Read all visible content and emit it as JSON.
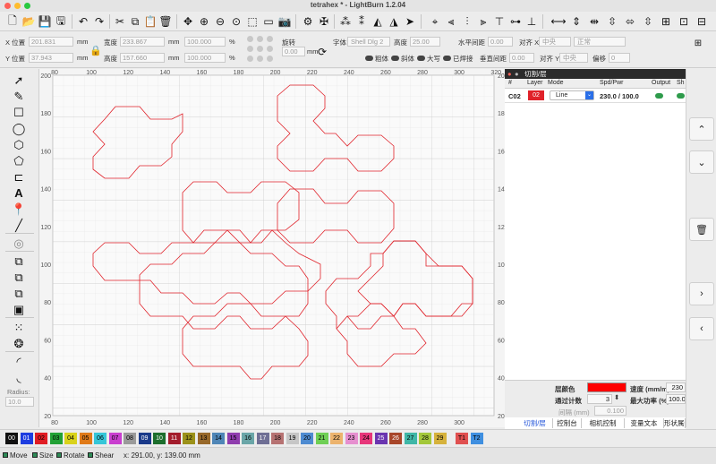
{
  "window": {
    "title": "tetrahex * - LightBurn 1.2.04"
  },
  "toolbar": {
    "icons": [
      "new-file-icon",
      "open-file-icon",
      "save-icon",
      "save-as-icon",
      "cut-icon",
      "copy-icon",
      "paste-icon",
      "delete-icon",
      "move-icon",
      "zoom-in-icon",
      "zoom-out-icon",
      "zoom-fit-icon",
      "frame-icon",
      "camera-icon",
      "settings-icon",
      "tools-icon",
      "group-icon",
      "ungroup-icon",
      "send-icon",
      "align-icon"
    ]
  },
  "numeric": {
    "x_label": "X 位置",
    "x_value": "201.831",
    "x_unit": "mm",
    "y_label": "Y 位置",
    "y_value": "37.943",
    "y_unit": "mm",
    "w_label": "宽度",
    "w_value": "233.867",
    "w_unit": "mm",
    "h_label": "高度",
    "h_value": "157.660",
    "h_unit": "mm",
    "pw_value": "100.000",
    "ph_value": "100.000",
    "pct": "%",
    "rotate_label": "旋转",
    "rotate_value": "0.00",
    "rotate_unit": "mm",
    "font_label": "字体",
    "font_value": "Shell Dlg 2",
    "height_label": "高度",
    "height_value": "25.00",
    "hspace_label": "水平间距",
    "hspace_value": "0.00",
    "align_x_label": "对齐 X",
    "align_x_value": "中央",
    "normal_value": "正常",
    "vspace_label": "垂直间距",
    "vspace_value": "0.00",
    "align_y_label": "对齐 Y",
    "align_y_value": "中央",
    "offset_label": "偏移",
    "offset_value": "0",
    "bold_label": "粗体",
    "italic_label": "斜体",
    "upper_label": "大写",
    "welded_label": "已焊接"
  },
  "lefttools": [
    "select-icon",
    "edit-nodes-icon",
    "rectangle-icon",
    "ellipse-icon",
    "polygon-icon",
    "draw-lines-icon",
    "position-laser-icon",
    "text-icon",
    "pin-icon",
    "measure-icon",
    "offset-icon",
    "boolean-union-icon",
    "boolean-subtract-icon",
    "boolean-intersect-icon",
    "weld-icon",
    "array-grid-icon",
    "circular-array-icon",
    "corner-round-icon",
    "corner-radius-icon"
  ],
  "radius": {
    "label": "Radius:",
    "value": "10.0"
  },
  "ruler": {
    "x_top": [
      "80",
      "100",
      "120",
      "140",
      "160",
      "180",
      "200",
      "220",
      "240",
      "260",
      "280",
      "300",
      "320"
    ],
    "x_bottom": [
      "80",
      "100",
      "120",
      "140",
      "160",
      "180",
      "200",
      "220",
      "240",
      "260",
      "280",
      "300"
    ],
    "y": [
      "200",
      "180",
      "160",
      "140",
      "120",
      "100",
      "80",
      "60",
      "40",
      "20"
    ]
  },
  "panel": {
    "header": "切割/层",
    "col_num": "#",
    "col_layer": "Layer",
    "col_mode": "Mode",
    "col_spd": "Spd/Pwr",
    "col_output": "Output",
    "col_show": "Sh",
    "row": {
      "num": "C02",
      "layer": "02",
      "mode": "Line",
      "spd": "230.0 / 100.0"
    },
    "layer_color_label": "层颜色",
    "speed_label": "速度 (mm/m)",
    "speed_value": "230",
    "passes_label": "通过计数",
    "passes_value": "3",
    "maxpower_label": "最大功率 (%)",
    "maxpower_value": "100.00",
    "interval_label": "间隔 (mm)",
    "interval_value": "0.100",
    "tabs": [
      "切割/层",
      "控制台",
      "相机控制",
      "变量文本",
      "形状属性"
    ]
  },
  "palette": {
    "colors": [
      {
        "label": "00",
        "color": "#111111"
      },
      {
        "label": "01",
        "color": "#1d3de0"
      },
      {
        "label": "02",
        "color": "#e01c24"
      },
      {
        "label": "03",
        "color": "#22a135"
      },
      {
        "label": "04",
        "color": "#d9d21b"
      },
      {
        "label": "05",
        "color": "#e07a18"
      },
      {
        "label": "06",
        "color": "#35c6d8"
      },
      {
        "label": "07",
        "color": "#c93ecf"
      },
      {
        "label": "08",
        "color": "#9a9a9a"
      },
      {
        "label": "09",
        "color": "#1a3a8a"
      },
      {
        "label": "10",
        "color": "#1c6e2d"
      },
      {
        "label": "11",
        "color": "#a31c2c"
      },
      {
        "label": "12",
        "color": "#9b9119"
      },
      {
        "label": "13",
        "color": "#97682a"
      },
      {
        "label": "14",
        "color": "#4f86b7"
      },
      {
        "label": "15",
        "color": "#8f3dae"
      },
      {
        "label": "16",
        "color": "#6aa6a8"
      },
      {
        "label": "17",
        "color": "#6f6f95"
      },
      {
        "label": "18",
        "color": "#b67272"
      },
      {
        "label": "19",
        "color": "#c6c6c6"
      },
      {
        "label": "20",
        "color": "#4e8bd1"
      },
      {
        "label": "21",
        "color": "#6fcf55"
      },
      {
        "label": "22",
        "color": "#ecb36d"
      },
      {
        "label": "23",
        "color": "#e68fcf"
      },
      {
        "label": "24",
        "color": "#e7367a"
      },
      {
        "label": "25",
        "color": "#6b35b0"
      },
      {
        "label": "26",
        "color": "#a8462a"
      },
      {
        "label": "27",
        "color": "#3fb7a7"
      },
      {
        "label": "28",
        "color": "#a3c83a"
      },
      {
        "label": "29",
        "color": "#d6b23c"
      },
      {
        "label": "T1",
        "color": "#e05050"
      },
      {
        "label": "T2",
        "color": "#3f8fe0"
      }
    ]
  },
  "status": {
    "move": "Move",
    "size": "Size",
    "rotate": "Rotate",
    "shear": "Shear",
    "coords": "x: 291.00, y: 139.00 mm"
  }
}
